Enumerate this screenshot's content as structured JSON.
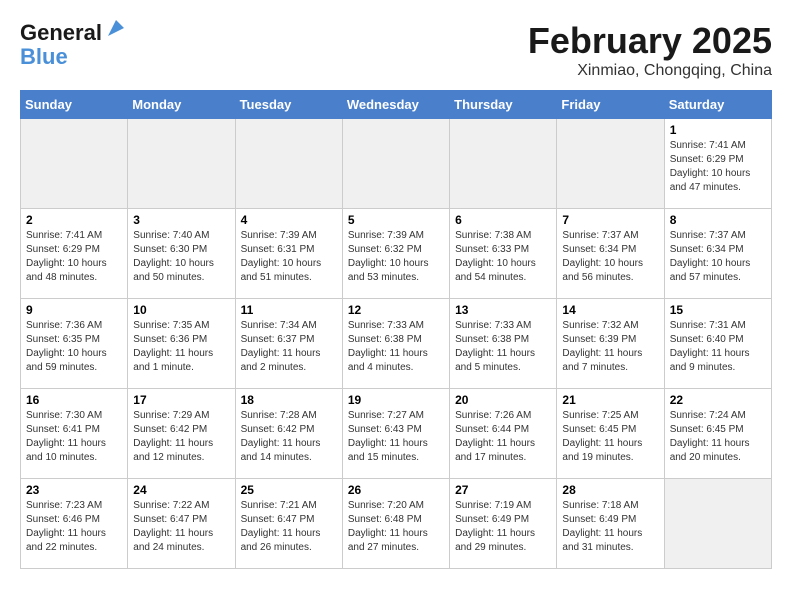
{
  "header": {
    "logo_line1": "General",
    "logo_line2": "Blue",
    "month_title": "February 2025",
    "location": "Xinmiao, Chongqing, China"
  },
  "weekdays": [
    "Sunday",
    "Monday",
    "Tuesday",
    "Wednesday",
    "Thursday",
    "Friday",
    "Saturday"
  ],
  "weeks": [
    [
      {
        "day": "",
        "empty": true
      },
      {
        "day": "",
        "empty": true
      },
      {
        "day": "",
        "empty": true
      },
      {
        "day": "",
        "empty": true
      },
      {
        "day": "",
        "empty": true
      },
      {
        "day": "",
        "empty": true
      },
      {
        "day": "1",
        "sunrise": "7:41 AM",
        "sunset": "6:29 PM",
        "daylight": "Daylight: 10 hours and 47 minutes."
      }
    ],
    [
      {
        "day": "2",
        "sunrise": "7:41 AM",
        "sunset": "6:29 PM",
        "daylight": "Daylight: 10 hours and 48 minutes."
      },
      {
        "day": "3",
        "sunrise": "7:40 AM",
        "sunset": "6:30 PM",
        "daylight": "Daylight: 10 hours and 50 minutes."
      },
      {
        "day": "4",
        "sunrise": "7:39 AM",
        "sunset": "6:31 PM",
        "daylight": "Daylight: 10 hours and 51 minutes."
      },
      {
        "day": "5",
        "sunrise": "7:39 AM",
        "sunset": "6:32 PM",
        "daylight": "Daylight: 10 hours and 53 minutes."
      },
      {
        "day": "6",
        "sunrise": "7:38 AM",
        "sunset": "6:33 PM",
        "daylight": "Daylight: 10 hours and 54 minutes."
      },
      {
        "day": "7",
        "sunrise": "7:37 AM",
        "sunset": "6:34 PM",
        "daylight": "Daylight: 10 hours and 56 minutes."
      },
      {
        "day": "8",
        "sunrise": "7:37 AM",
        "sunset": "6:34 PM",
        "daylight": "Daylight: 10 hours and 57 minutes."
      }
    ],
    [
      {
        "day": "9",
        "sunrise": "7:36 AM",
        "sunset": "6:35 PM",
        "daylight": "Daylight: 10 hours and 59 minutes."
      },
      {
        "day": "10",
        "sunrise": "7:35 AM",
        "sunset": "6:36 PM",
        "daylight": "Daylight: 11 hours and 1 minute."
      },
      {
        "day": "11",
        "sunrise": "7:34 AM",
        "sunset": "6:37 PM",
        "daylight": "Daylight: 11 hours and 2 minutes."
      },
      {
        "day": "12",
        "sunrise": "7:33 AM",
        "sunset": "6:38 PM",
        "daylight": "Daylight: 11 hours and 4 minutes."
      },
      {
        "day": "13",
        "sunrise": "7:33 AM",
        "sunset": "6:38 PM",
        "daylight": "Daylight: 11 hours and 5 minutes."
      },
      {
        "day": "14",
        "sunrise": "7:32 AM",
        "sunset": "6:39 PM",
        "daylight": "Daylight: 11 hours and 7 minutes."
      },
      {
        "day": "15",
        "sunrise": "7:31 AM",
        "sunset": "6:40 PM",
        "daylight": "Daylight: 11 hours and 9 minutes."
      }
    ],
    [
      {
        "day": "16",
        "sunrise": "7:30 AM",
        "sunset": "6:41 PM",
        "daylight": "Daylight: 11 hours and 10 minutes."
      },
      {
        "day": "17",
        "sunrise": "7:29 AM",
        "sunset": "6:42 PM",
        "daylight": "Daylight: 11 hours and 12 minutes."
      },
      {
        "day": "18",
        "sunrise": "7:28 AM",
        "sunset": "6:42 PM",
        "daylight": "Daylight: 11 hours and 14 minutes."
      },
      {
        "day": "19",
        "sunrise": "7:27 AM",
        "sunset": "6:43 PM",
        "daylight": "Daylight: 11 hours and 15 minutes."
      },
      {
        "day": "20",
        "sunrise": "7:26 AM",
        "sunset": "6:44 PM",
        "daylight": "Daylight: 11 hours and 17 minutes."
      },
      {
        "day": "21",
        "sunrise": "7:25 AM",
        "sunset": "6:45 PM",
        "daylight": "Daylight: 11 hours and 19 minutes."
      },
      {
        "day": "22",
        "sunrise": "7:24 AM",
        "sunset": "6:45 PM",
        "daylight": "Daylight: 11 hours and 20 minutes."
      }
    ],
    [
      {
        "day": "23",
        "sunrise": "7:23 AM",
        "sunset": "6:46 PM",
        "daylight": "Daylight: 11 hours and 22 minutes."
      },
      {
        "day": "24",
        "sunrise": "7:22 AM",
        "sunset": "6:47 PM",
        "daylight": "Daylight: 11 hours and 24 minutes."
      },
      {
        "day": "25",
        "sunrise": "7:21 AM",
        "sunset": "6:47 PM",
        "daylight": "Daylight: 11 hours and 26 minutes."
      },
      {
        "day": "26",
        "sunrise": "7:20 AM",
        "sunset": "6:48 PM",
        "daylight": "Daylight: 11 hours and 27 minutes."
      },
      {
        "day": "27",
        "sunrise": "7:19 AM",
        "sunset": "6:49 PM",
        "daylight": "Daylight: 11 hours and 29 minutes."
      },
      {
        "day": "28",
        "sunrise": "7:18 AM",
        "sunset": "6:49 PM",
        "daylight": "Daylight: 11 hours and 31 minutes."
      },
      {
        "day": "",
        "empty": true
      }
    ]
  ]
}
